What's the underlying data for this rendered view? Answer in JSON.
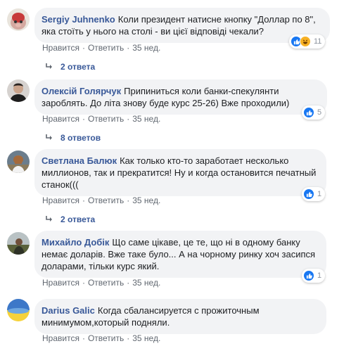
{
  "comments": [
    {
      "author": "Sergiy Juhnenko",
      "text": "Коли президент натисне кнопку \"Доллар по 8\", яка стоїть у нього на столі - ви цієї відповіді чекали?",
      "like_label": "Нравится",
      "reply_label": "Ответить",
      "time": "35 нед.",
      "reaction_count": "11",
      "reactions": [
        "like-icon",
        "haha-icon"
      ],
      "replies_label": "2 ответа"
    },
    {
      "author": "Олексій Голярчук",
      "text": "Припиниться коли банки-спекулянти зароблять. До літа знову буде курс 25-26) Вже проходили)",
      "like_label": "Нравится",
      "reply_label": "Ответить",
      "time": "35 нед.",
      "reaction_count": "5",
      "reactions": [
        "like-icon"
      ],
      "replies_label": "8 ответов"
    },
    {
      "author": "Светлана Балюк",
      "text": "Как только кто-то заработает несколько миллионов, так и прекратится! Ну и когда остановится печатный станок(((",
      "like_label": "Нравится",
      "reply_label": "Ответить",
      "time": "35 нед.",
      "reaction_count": "1",
      "reactions": [
        "like-icon"
      ],
      "replies_label": "2 ответа"
    },
    {
      "author": "Михайло Добік",
      "text": "Що саме цікаве, це те, що ні в одному банку немає доларів. Вже таке було... А на чорному ринку хоч засипся доларами, тільки курс який.",
      "like_label": "Нравится",
      "reply_label": "Ответить",
      "time": "35 нед.",
      "reaction_count": "1",
      "reactions": [
        "like-icon"
      ]
    },
    {
      "author": "Darius Galic",
      "text": "Когда сбалансируется с прожиточным минимумом,который подняли.",
      "like_label": "Нравится",
      "reply_label": "Ответить",
      "time": "35 нед."
    }
  ],
  "colors": {
    "author_link": "#385898",
    "bubble_bg": "#f2f3f5",
    "meta_text": "#606770",
    "like_blue": "#1877f2",
    "haha_yellow": "#f7b125"
  }
}
